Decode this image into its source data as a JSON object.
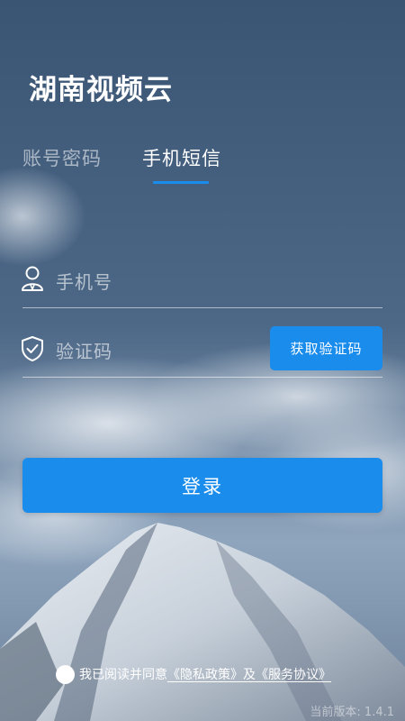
{
  "app": {
    "title": "湖南视频云"
  },
  "tabs": [
    {
      "label": "账号密码",
      "active": false
    },
    {
      "label": "手机短信",
      "active": true
    }
  ],
  "form": {
    "phone_placeholder": "手机号",
    "phone_value": "",
    "phone_icon": "user-icon",
    "code_placeholder": "验证码",
    "code_value": "",
    "code_icon": "shield-check-icon",
    "get_code_label": "获取验证码",
    "login_label": "登录"
  },
  "agreement": {
    "prefix": "我已阅读并同意",
    "privacy_link": "《隐私政策》",
    "conjunction": "及",
    "service_link": "《服务协议》",
    "checked": false
  },
  "footer": {
    "version_label": "当前版本: 1.4.1"
  },
  "colors": {
    "accent": "#1a8cec",
    "sky_top": "#3a5574",
    "sky_bottom": "#8fa5bd"
  }
}
